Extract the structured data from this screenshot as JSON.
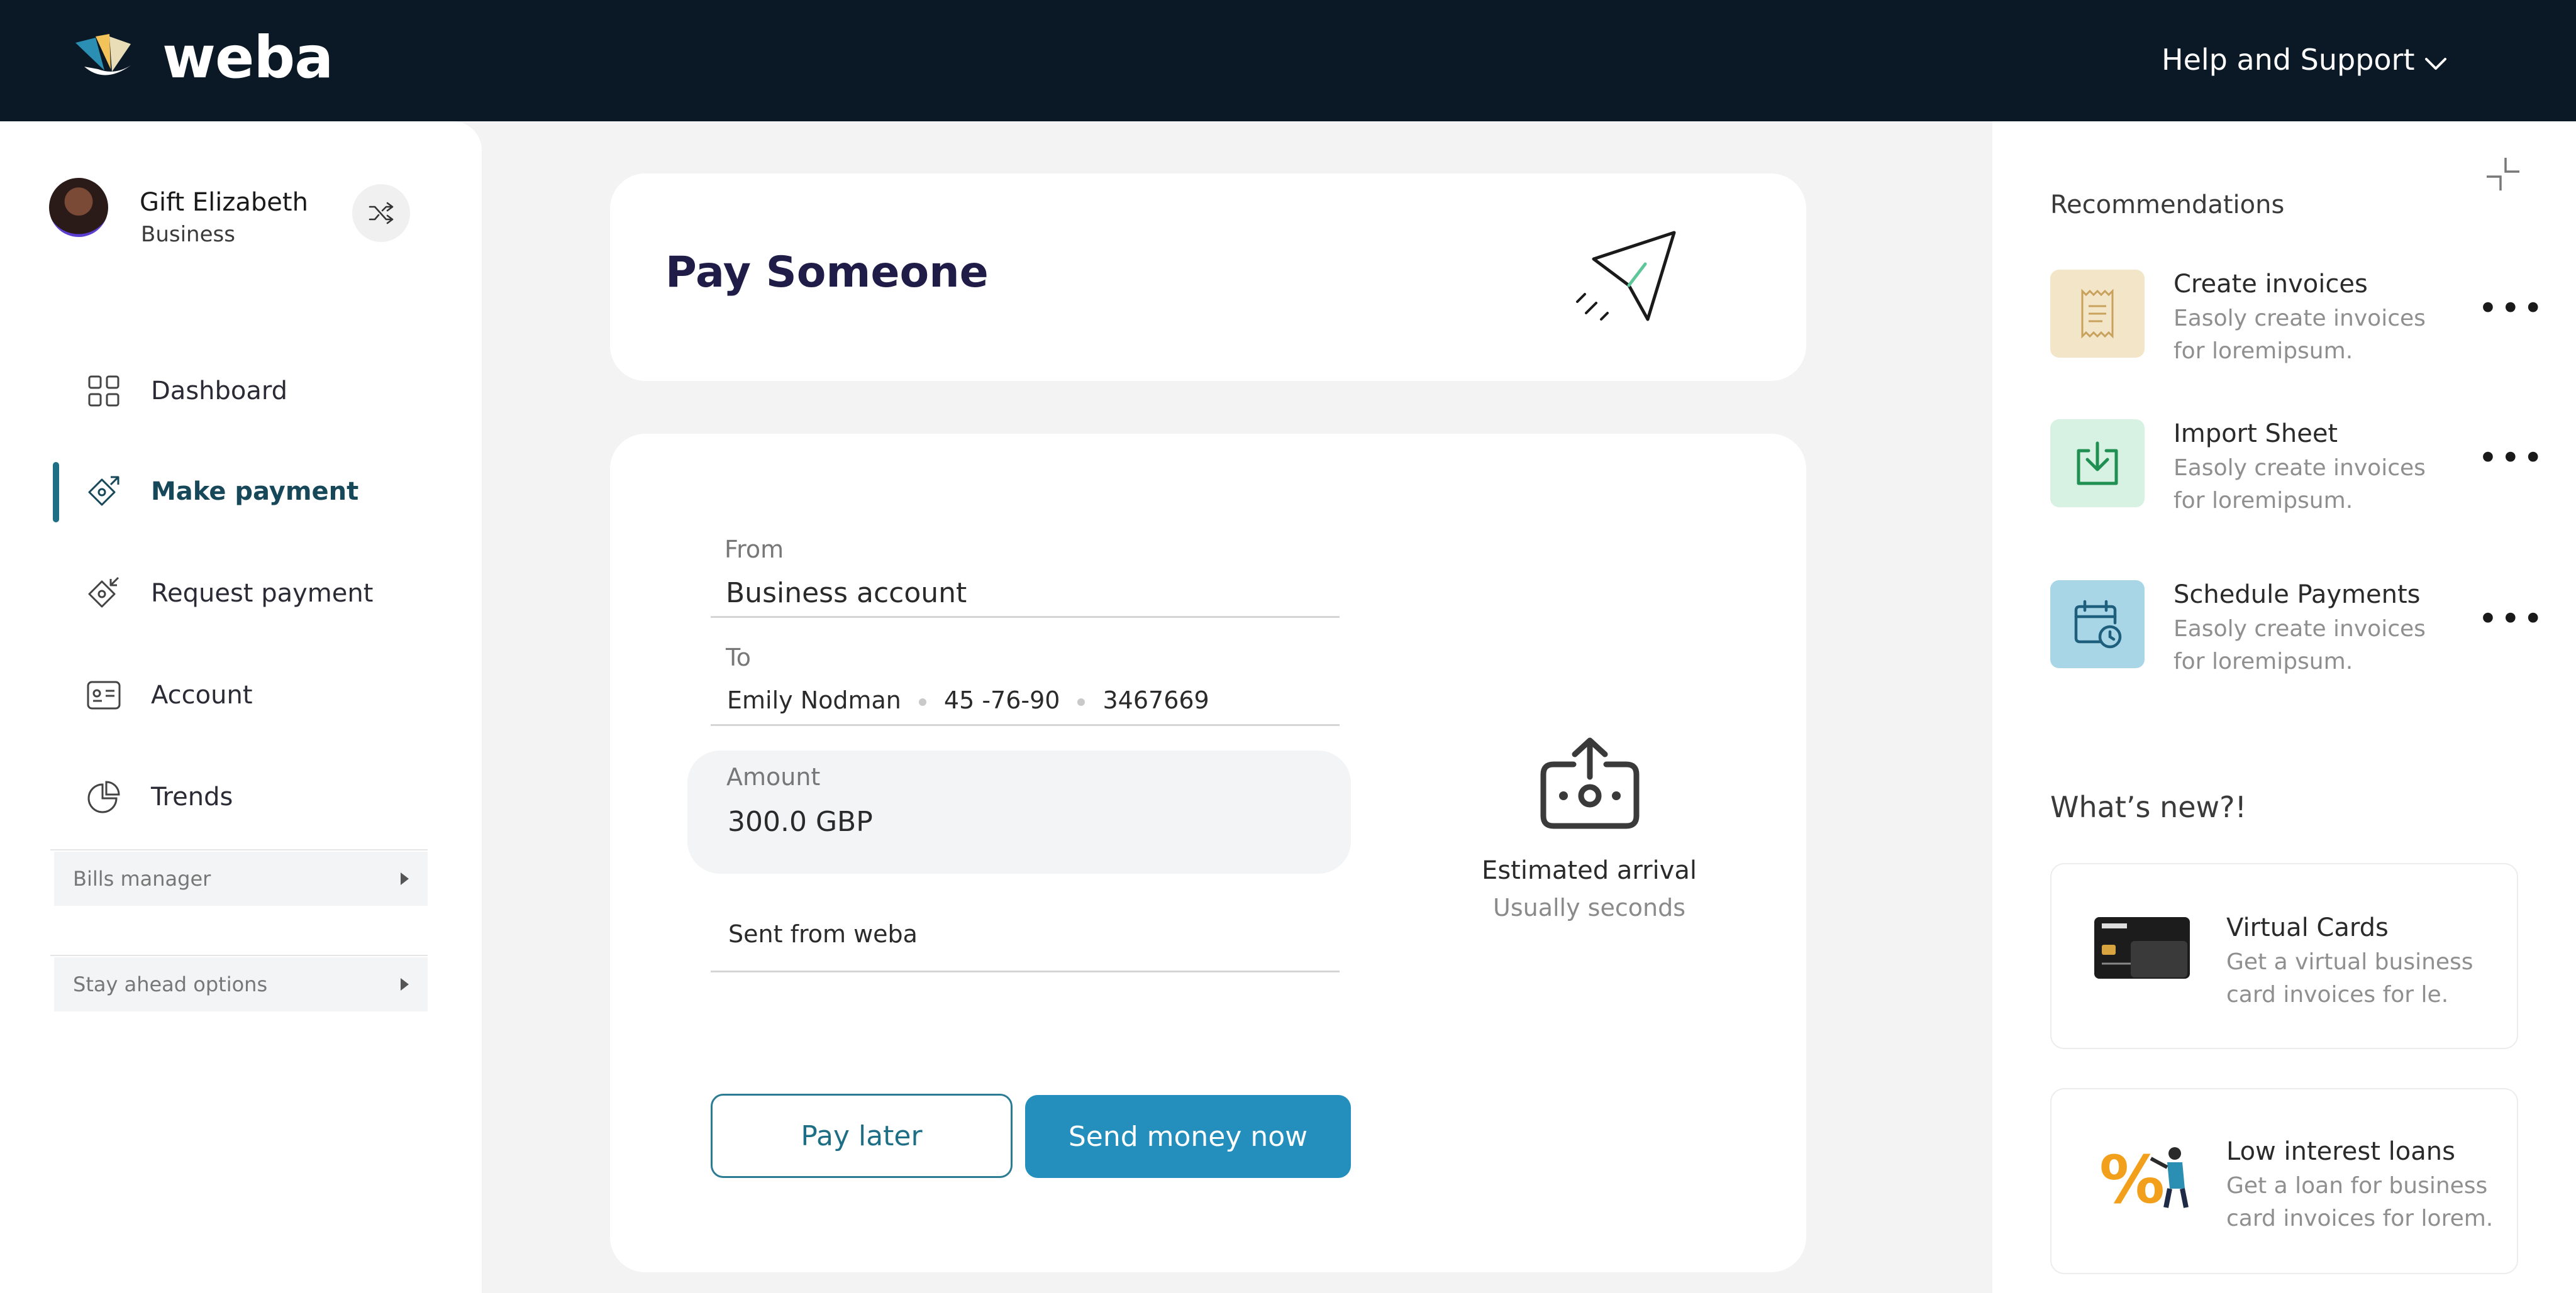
{
  "header": {
    "brand": "weba",
    "help_label": "Help and Support"
  },
  "user": {
    "name": "Gift Elizabeth",
    "role": "Business"
  },
  "nav": {
    "items": [
      {
        "label": "Dashboard",
        "icon": "grid-icon"
      },
      {
        "label": "Make payment",
        "icon": "make-payment-icon",
        "active": true
      },
      {
        "label": "Request payment",
        "icon": "request-payment-icon"
      },
      {
        "label": "Account",
        "icon": "account-card-icon"
      },
      {
        "label": "Trends",
        "icon": "pie-chart-icon"
      }
    ],
    "sections": [
      "Bills manager",
      "Stay ahead options"
    ]
  },
  "pay": {
    "title": "Pay Someone",
    "from_label": "From",
    "from_value": "Business account",
    "to_label": "To",
    "to_name": "Emily Nodman",
    "to_sort_code": "45 -76-90",
    "to_account": "3467669",
    "amount_label": "Amount",
    "amount_value": "300.0 GBP",
    "reference_value": "Sent from weba",
    "pay_later_label": "Pay later",
    "send_label": "Send money now",
    "estimate_title": "Estimated arrival",
    "estimate_sub": "Usually seconds"
  },
  "recommendations": {
    "title": "Recommendations",
    "items": [
      {
        "name": "Create invoices",
        "desc": "Easoly create invoices for loremipsum.",
        "icon": "receipt-icon",
        "bg": "#f3e6c8"
      },
      {
        "name": "Import Sheet",
        "desc": "Easoly create invoices for loremipsum.",
        "icon": "download-tray-icon",
        "bg": "#d7f2e3"
      },
      {
        "name": "Schedule Payments",
        "desc": "Easoly create invoices for loremipsum.",
        "icon": "calendar-clock-icon",
        "bg": "#a9d6e6"
      }
    ]
  },
  "whats_new": {
    "title": "What’s new?!",
    "items": [
      {
        "name": "Virtual Cards",
        "desc": "Get a virtual business card invoices for le."
      },
      {
        "name": "Low interest loans",
        "desc": "Get a loan for  business card invoices for lorem."
      }
    ]
  },
  "colors": {
    "topbar": "#0b1825",
    "accent": "#248fbd",
    "active_nav": "#17485a"
  }
}
